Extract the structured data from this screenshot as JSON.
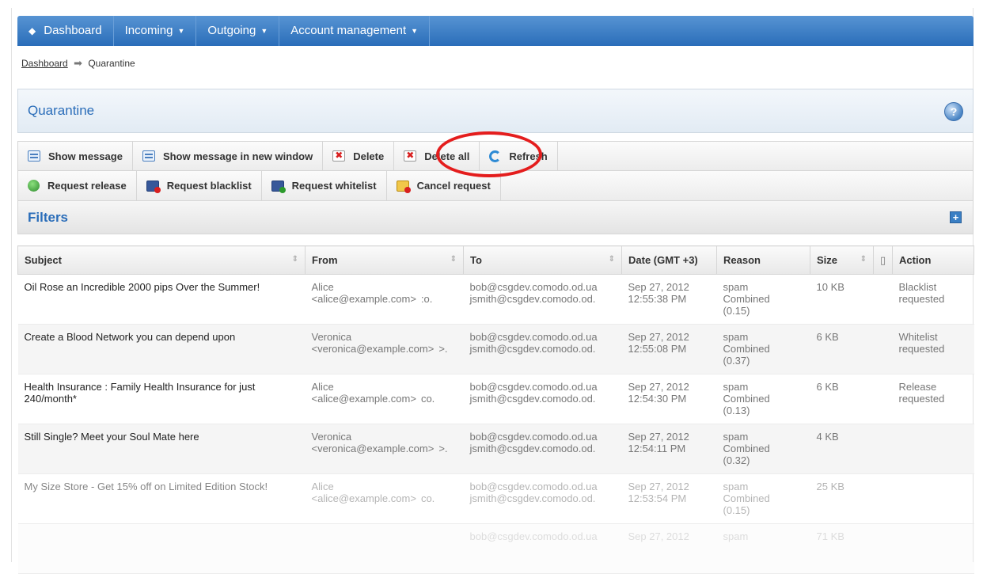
{
  "nav": {
    "dashboard": "Dashboard",
    "incoming": "Incoming",
    "outgoing": "Outgoing",
    "account": "Account management"
  },
  "breadcrumb": {
    "home": "Dashboard",
    "current": "Quarantine"
  },
  "panel": {
    "title": "Quarantine",
    "help": "?"
  },
  "toolbar": {
    "show_message": "Show message",
    "show_new_window": "Show message in new window",
    "delete": "Delete",
    "delete_all": "Delete all",
    "refresh": "Refresh",
    "request_release": "Request release",
    "request_blacklist": "Request blacklist",
    "request_whitelist": "Request whitelist",
    "cancel_request": "Cancel request"
  },
  "filters": {
    "title": "Filters",
    "expand": "+"
  },
  "table": {
    "columns": [
      "Subject",
      "From",
      "To",
      "Date (GMT +3)",
      "Reason",
      "Size",
      "Action"
    ],
    "rows": [
      {
        "subject": "Oil Rose an Incredible 2000 pips Over the Summer!",
        "from_name": "Alice",
        "from_email": "<alice@example.com>",
        "from_extra": ":o.",
        "to1": "bob@csgdev.comodo.od.ua",
        "to2": "jsmith@csgdev.comodo.od.",
        "date1": "Sep 27, 2012",
        "date2": "12:55:38 PM",
        "reason1": "spam",
        "reason2": "Combined",
        "reason3": "(0.15)",
        "size": "10 KB",
        "action1": "Blacklist",
        "action2": "requested"
      },
      {
        "subject": "Create a Blood Network you can depend upon",
        "from_name": "Veronica",
        "from_email": "<veronica@example.com>",
        "from_extra": ">.",
        "to1": "bob@csgdev.comodo.od.ua",
        "to2": "jsmith@csgdev.comodo.od.",
        "date1": "Sep 27, 2012",
        "date2": "12:55:08 PM",
        "reason1": "spam",
        "reason2": "Combined",
        "reason3": "(0.37)",
        "size": "6 KB",
        "action1": "Whitelist",
        "action2": "requested"
      },
      {
        "subject": "Health Insurance : Family Health Insurance for just 240/month*",
        "from_name": "Alice",
        "from_email": "<alice@example.com>",
        "from_extra": "co.",
        "to1": "bob@csgdev.comodo.od.ua",
        "to2": "jsmith@csgdev.comodo.od.",
        "date1": "Sep 27, 2012",
        "date2": "12:54:30 PM",
        "reason1": "spam",
        "reason2": "Combined",
        "reason3": "(0.13)",
        "size": "6 KB",
        "action1": "Release",
        "action2": "requested"
      },
      {
        "subject": "Still Single? Meet your Soul Mate here",
        "from_name": "Veronica",
        "from_email": "<veronica@example.com>",
        "from_extra": ">.",
        "to1": "bob@csgdev.comodo.od.ua",
        "to2": "jsmith@csgdev.comodo.od.",
        "date1": "Sep 27, 2012",
        "date2": "12:54:11 PM",
        "reason1": "spam",
        "reason2": "Combined",
        "reason3": "(0.32)",
        "size": "4 KB",
        "action1": "",
        "action2": ""
      },
      {
        "subject": "My Size Store - Get 15% off on Limited Edition Stock!",
        "from_name": "Alice",
        "from_email": "<alice@example.com>",
        "from_extra": "co.",
        "to1": "bob@csgdev.comodo.od.ua",
        "to2": "jsmith@csgdev.comodo.od.",
        "date1": "Sep 27, 2012",
        "date2": "12:53:54 PM",
        "reason1": "spam",
        "reason2": "Combined",
        "reason3": "(0.15)",
        "size": "25 KB",
        "action1": "",
        "action2": ""
      },
      {
        "subject": "",
        "from_name": "",
        "from_email": "",
        "from_extra": "",
        "to1": "bob@csgdev.comodo.od.ua",
        "to2": "",
        "date1": "Sep 27, 2012",
        "date2": "",
        "reason1": "spam",
        "reason2": "",
        "reason3": "",
        "size": "71 KB",
        "action1": "",
        "action2": ""
      }
    ]
  },
  "colors": {
    "nav_blue": "#2a6db9",
    "title_blue": "#2a6db9",
    "highlight_red": "#e41d1d"
  }
}
